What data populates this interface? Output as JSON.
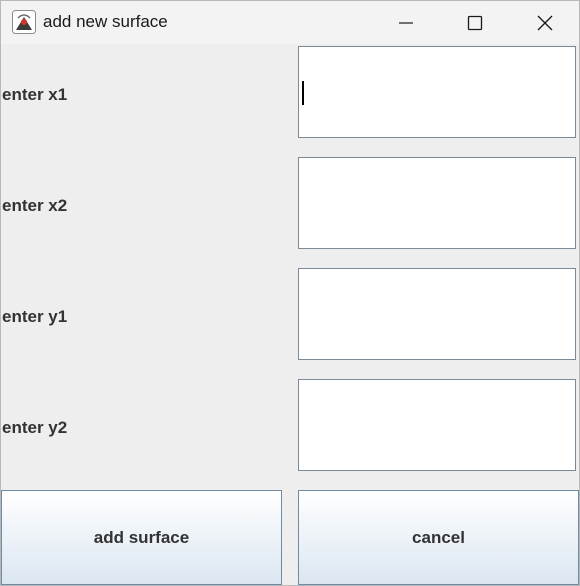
{
  "window": {
    "title": "add new surface",
    "app_icon": "java-icon",
    "controls": [
      "minimize-icon",
      "maximize-icon",
      "close-icon"
    ]
  },
  "form": {
    "fields": [
      {
        "label": "enter x1",
        "value": ""
      },
      {
        "label": "enter x2",
        "value": ""
      },
      {
        "label": "enter y1",
        "value": ""
      },
      {
        "label": "enter y2",
        "value": ""
      }
    ]
  },
  "buttons": {
    "add_label": "add surface",
    "cancel_label": "cancel"
  }
}
